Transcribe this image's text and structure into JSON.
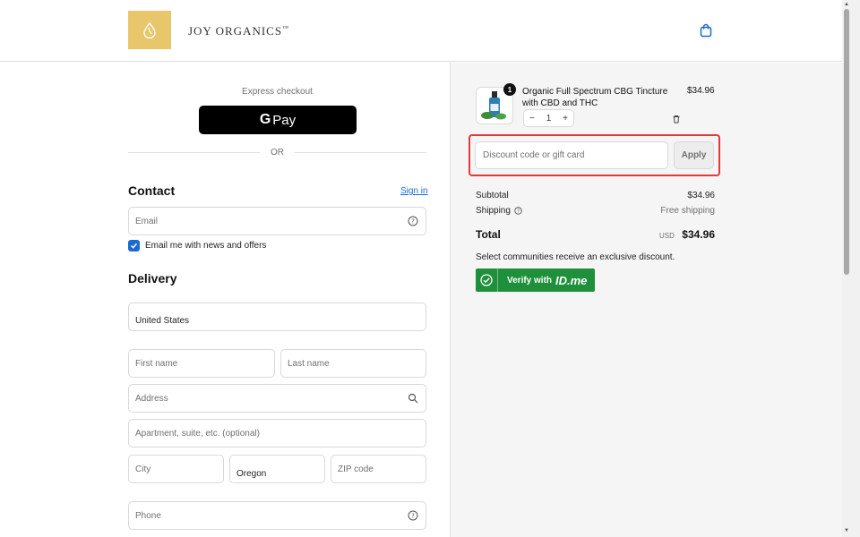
{
  "header": {
    "brand_name": "JOY ORGANICS",
    "brand_mark": "™",
    "logo_icon": "drop-logo-icon",
    "cart_icon": "shopping-bag-icon"
  },
  "express": {
    "label": "Express checkout",
    "gpay_g": "G",
    "gpay_text": "Pay",
    "or_label": "OR"
  },
  "contact": {
    "title": "Contact",
    "sign_in": "Sign in",
    "email_placeholder": "Email",
    "newsletter_label": "Email me with news and offers",
    "newsletter_checked": true
  },
  "delivery": {
    "title": "Delivery",
    "country_value": "United States",
    "first_name_placeholder": "First name",
    "last_name_placeholder": "Last name",
    "address_placeholder": "Address",
    "apartment_placeholder": "Apartment, suite, etc. (optional)",
    "city_placeholder": "City",
    "state_value": "Oregon",
    "zip_placeholder": "ZIP code",
    "phone_placeholder": "Phone"
  },
  "summary": {
    "item": {
      "quantity_badge": "1",
      "name": "Organic Full Spectrum CBG Tincture with CBD and THC",
      "price": "$34.96",
      "quantity": "1",
      "minus": "−",
      "plus": "+"
    },
    "discount_placeholder": "Discount code or gift card",
    "apply_label": "Apply",
    "subtotal_label": "Subtotal",
    "subtotal_value": "$34.96",
    "shipping_label": "Shipping",
    "shipping_value": "Free shipping",
    "total_label": "Total",
    "total_currency": "USD",
    "total_value": "$34.96",
    "communities_text": "Select communities receive an exclusive discount.",
    "verify_label": "Verify with",
    "verify_brand": "ID.me"
  },
  "colors": {
    "accent": "#1a6ad6",
    "logo_bg": "#e8c76c",
    "highlight": "#e03a3a",
    "verify_green": "#1e8f3a"
  }
}
